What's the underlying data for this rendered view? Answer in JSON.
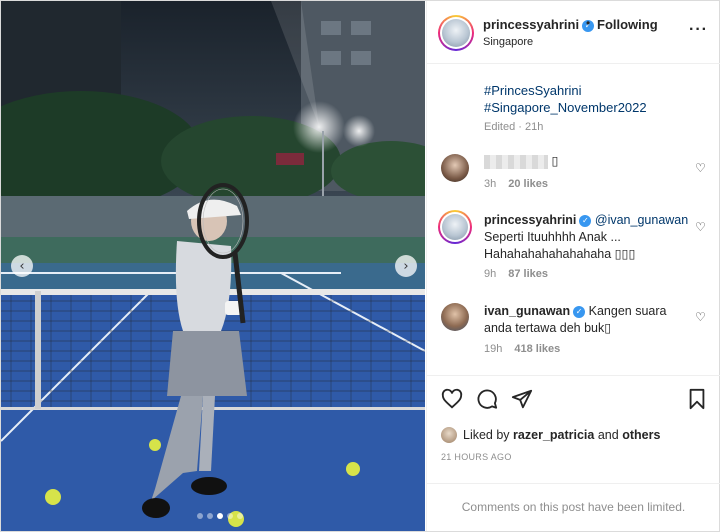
{
  "header": {
    "username": "princessyahrini",
    "separator": "•",
    "follow_status": "Following",
    "location": "Singapore",
    "more_icon": "more-horizontal-icon"
  },
  "caption": {
    "hashtag_1": "#PrincesSyahrini",
    "hashtag_2": "#Singapore_November2022",
    "edited": "Edited · 21h"
  },
  "comments": [
    {
      "username": "",
      "text": "▯",
      "time": "3h",
      "likes": "20 likes"
    },
    {
      "username": "princessyahrini",
      "mention": "@ivan_gunawan",
      "text_line1": "Seperti Ituuhhhh Anak ...",
      "text_line2": "Hahahahahahahahaha ▯▯▯",
      "time": "9h",
      "likes": "87 likes"
    },
    {
      "username": "ivan_gunawan",
      "text_line1": "Kangen suara",
      "text_line2": "anda tertawa deh buk▯",
      "time": "19h",
      "likes": "418 likes"
    }
  ],
  "liked_by": {
    "prefix": "Liked by",
    "user": "razer_patricia",
    "and": "and",
    "others": "others"
  },
  "timestamp": "21 HOURS AGO",
  "comments_limited": "Comments on this post have been limited.",
  "colors": {
    "link": "#00376b",
    "verified": "#3897f0",
    "court": "#2f5aa8",
    "meta": "#8e8e8e"
  }
}
